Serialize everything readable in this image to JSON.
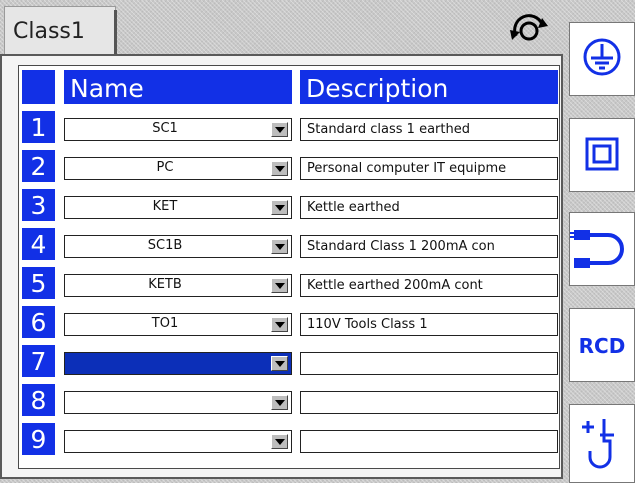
{
  "window": {
    "tab_label": "Class1",
    "refresh_icon": "refresh-icon"
  },
  "colors": {
    "header_blue": "#1230e6",
    "selected_blue": "#0c2fb8"
  },
  "table": {
    "headers": {
      "name": "Name",
      "description": "Description"
    },
    "rows": [
      {
        "num": "1",
        "name": "SC1",
        "description": "Standard class 1 earthed"
      },
      {
        "num": "2",
        "name": "PC",
        "description": "Personal computer IT equipme"
      },
      {
        "num": "3",
        "name": "KET",
        "description": "Kettle earthed"
      },
      {
        "num": "4",
        "name": "SC1B",
        "description": "Standard Class 1 200mA con"
      },
      {
        "num": "5",
        "name": "KETB",
        "description": "Kettle earthed 200mA cont"
      },
      {
        "num": "6",
        "name": "TO1",
        "description": "110V Tools Class 1"
      },
      {
        "num": "7",
        "name": "",
        "description": "",
        "selected": true
      },
      {
        "num": "8",
        "name": "",
        "description": ""
      },
      {
        "num": "9",
        "name": "",
        "description": ""
      }
    ]
  },
  "sidebar": {
    "buttons": [
      {
        "icon": "earth-ground-icon"
      },
      {
        "icon": "class-2-double-square-icon"
      },
      {
        "icon": "iec-lead-icon"
      },
      {
        "icon": "rcd-icon",
        "label": "RCD"
      },
      {
        "icon": "add-probe-icon"
      }
    ]
  }
}
